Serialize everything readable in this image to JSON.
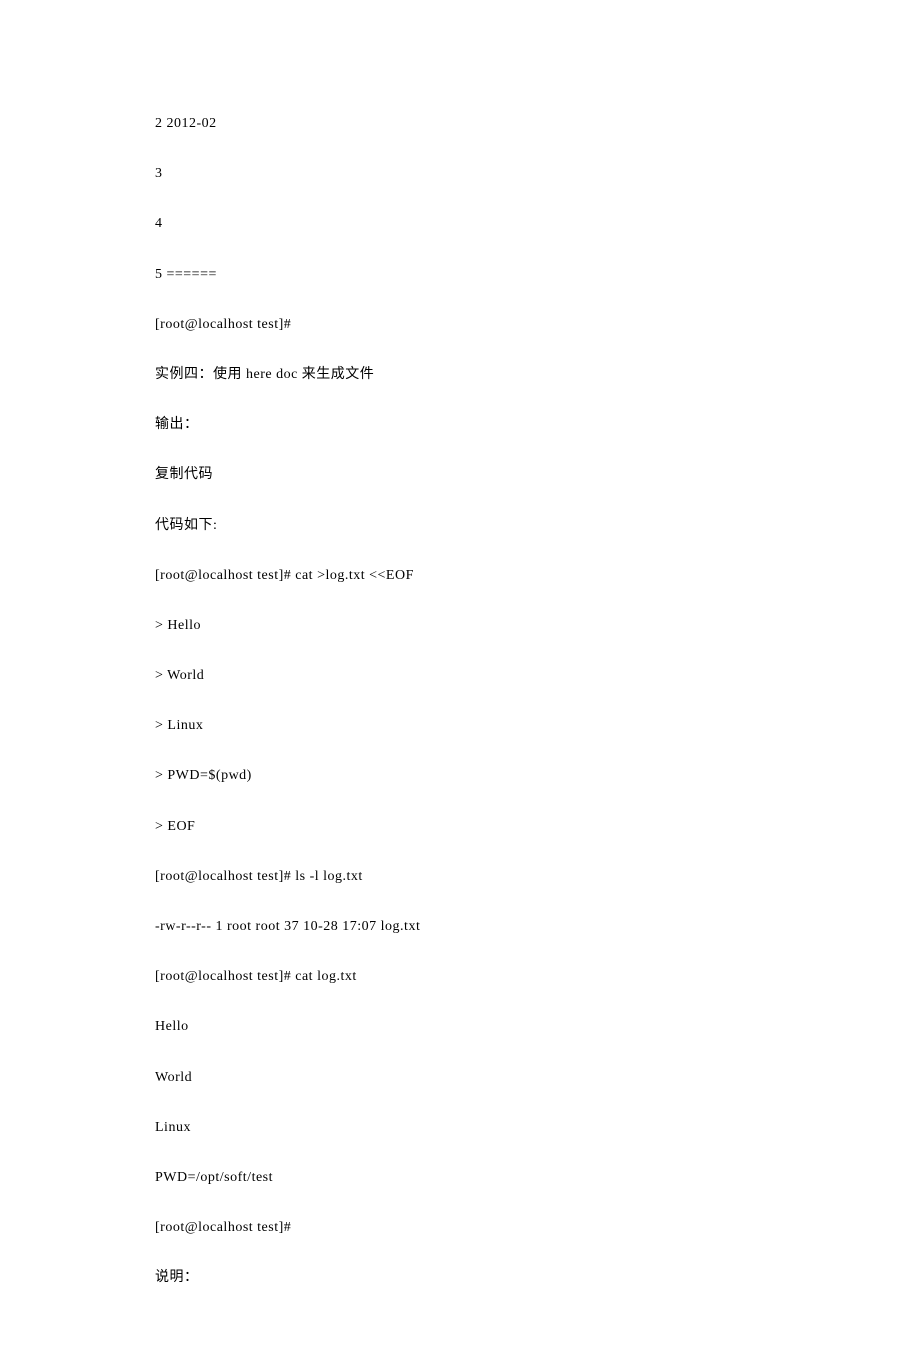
{
  "lines": [
    "2 2012-02",
    "3",
    "4",
    "5 ======",
    "[root@localhost test]#",
    "实例四：使用 here doc 来生成文件",
    "输出：",
    "复制代码",
    "代码如下:",
    "[root@localhost test]# cat >log.txt <<EOF",
    "> Hello",
    "> World",
    "> Linux",
    "> PWD=$(pwd)",
    "> EOF",
    "[root@localhost test]# ls -l log.txt",
    "-rw-r--r-- 1 root root 37 10-28 17:07 log.txt",
    "[root@localhost test]# cat log.txt",
    "Hello",
    "World",
    "Linux",
    "PWD=/opt/soft/test",
    "[root@localhost test]#",
    "说明："
  ]
}
